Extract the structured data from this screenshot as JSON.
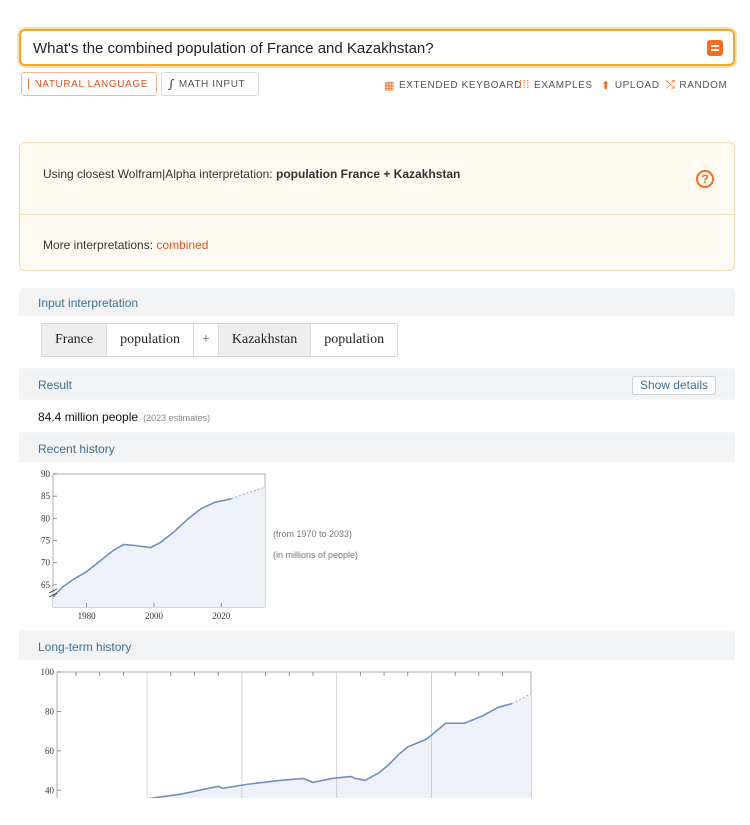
{
  "search": {
    "query": "What's the combined population of France and Kazakhstan?"
  },
  "modes": {
    "natural_language": "NATURAL LANGUAGE",
    "math_input": "MATH INPUT"
  },
  "tools": {
    "extended_keyboard": "EXTENDED KEYBOARD",
    "examples": "EXAMPLES",
    "upload": "UPLOAD",
    "random": "RANDOM"
  },
  "interpretation": {
    "prefix": "Using closest Wolfram|Alpha interpretation: ",
    "bold": "population France + Kazakhstan",
    "more_label": "More interpretations: ",
    "more_link": "combined"
  },
  "pods": {
    "input_interpretation": {
      "title": "Input interpretation",
      "cells": [
        "France",
        "population",
        "+",
        "Kazakhstan",
        "population"
      ]
    },
    "result": {
      "title": "Result",
      "show_details": "Show details",
      "value": "84.4 million people",
      "note": "(2023 estimates)"
    },
    "recent_history": {
      "title": "Recent history",
      "range_note": "(from 1970 to 2033)",
      "unit_note": "(in millions of people)"
    },
    "long_term_history": {
      "title": "Long-term history"
    }
  },
  "chart_data": [
    {
      "type": "line",
      "title": "",
      "xlabel": "",
      "ylabel": "",
      "xlim": [
        1970,
        2033
      ],
      "ylim": [
        60,
        90
      ],
      "x_ticks": [
        1980,
        2000,
        2020
      ],
      "y_ticks": [
        65,
        70,
        75,
        80,
        85,
        90
      ],
      "series": [
        {
          "values": [
            [
              1970,
              62.3
            ],
            [
              1973,
              64.6
            ],
            [
              1976,
              66.2
            ],
            [
              1980,
              68.0
            ],
            [
              1984,
              70.4
            ],
            [
              1988,
              72.8
            ],
            [
              1991,
              74.1
            ],
            [
              1994,
              73.9
            ],
            [
              1999,
              73.4
            ],
            [
              2002,
              74.6
            ],
            [
              2006,
              77.0
            ],
            [
              2010,
              79.8
            ],
            [
              2014,
              82.2
            ],
            [
              2018,
              83.6
            ],
            [
              2023,
              84.4
            ]
          ]
        },
        {
          "values": [
            [
              2023,
              84.4
            ],
            [
              2028,
              85.8
            ],
            [
              2033,
              87.0
            ]
          ]
        }
      ]
    },
    {
      "type": "area",
      "title": "",
      "xlabel": "",
      "ylabel": "",
      "ylim": [
        30,
        100
      ],
      "y_ticks": [
        40,
        60,
        80,
        100
      ],
      "series": [
        {
          "values": [
            [
              0,
              31
            ],
            [
              8,
              32
            ],
            [
              14,
              34
            ],
            [
              20,
              36
            ],
            [
              26,
              38
            ],
            [
              30,
              40
            ],
            [
              34,
              42
            ],
            [
              35,
              41
            ],
            [
              40,
              43
            ],
            [
              47,
              45
            ],
            [
              52,
              46
            ],
            [
              54,
              44
            ],
            [
              58,
              46
            ],
            [
              62,
              47
            ],
            [
              63,
              46
            ],
            [
              65,
              45
            ],
            [
              68,
              49
            ],
            [
              70,
              53
            ],
            [
              72,
              58
            ],
            [
              74,
              62
            ],
            [
              78,
              66
            ],
            [
              80,
              70
            ],
            [
              82,
              74
            ],
            [
              86,
              74
            ],
            [
              90,
              78
            ],
            [
              93,
              82
            ],
            [
              96,
              84
            ]
          ]
        },
        {
          "values": [
            [
              96,
              84
            ],
            [
              100,
              89
            ]
          ]
        }
      ]
    }
  ]
}
